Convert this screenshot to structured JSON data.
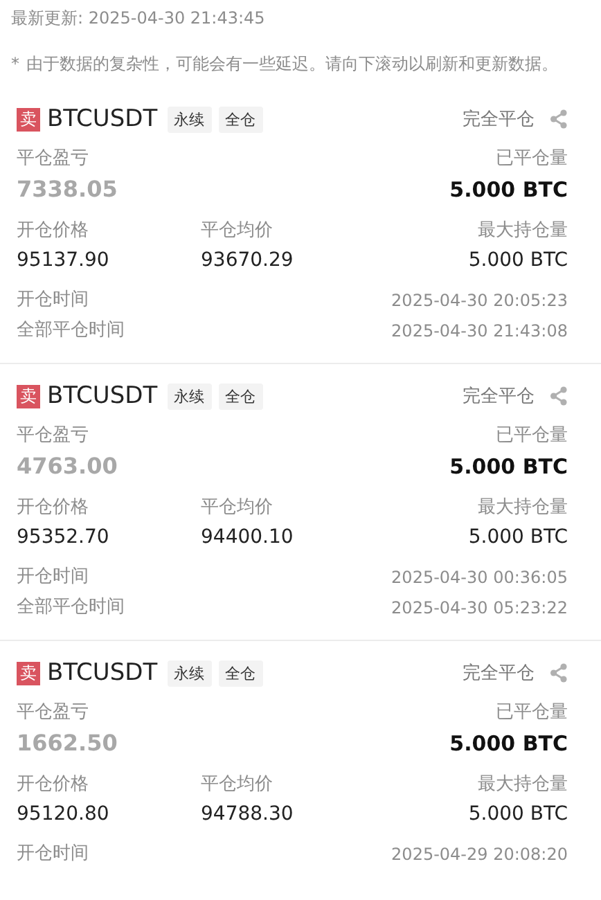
{
  "last_update": "最新更新: 2025-04-30 21:43:45",
  "note_mark": "*",
  "note": "由于数据的复杂性，可能会有一些延迟。请向下滚动以刷新和更新数据。",
  "positions": [
    {
      "side": "卖",
      "symbol": "BTCUSDT",
      "tags": [
        "永续",
        "全仓"
      ],
      "status": "完全平仓",
      "pnl_label": "平仓盈亏",
      "pnl": "7338.05",
      "closed_qty_label": "已平仓量",
      "closed_qty": "5.000 BTC",
      "open_price_label": "开仓价格",
      "open_price": "95137.90",
      "avg_close_label": "平仓均价",
      "avg_close": "93670.29",
      "max_qty_label": "最大持仓量",
      "max_qty": "5.000 BTC",
      "open_time_label": "开仓时间",
      "open_time": "2025-04-30 20:05:23",
      "close_time_label": "全部平仓时间",
      "close_time": "2025-04-30 21:43:08"
    },
    {
      "side": "卖",
      "symbol": "BTCUSDT",
      "tags": [
        "永续",
        "全仓"
      ],
      "status": "完全平仓",
      "pnl_label": "平仓盈亏",
      "pnl": "4763.00",
      "closed_qty_label": "已平仓量",
      "closed_qty": "5.000 BTC",
      "open_price_label": "开仓价格",
      "open_price": "95352.70",
      "avg_close_label": "平仓均价",
      "avg_close": "94400.10",
      "max_qty_label": "最大持仓量",
      "max_qty": "5.000 BTC",
      "open_time_label": "开仓时间",
      "open_time": "2025-04-30 00:36:05",
      "close_time_label": "全部平仓时间",
      "close_time": "2025-04-30 05:23:22"
    },
    {
      "side": "卖",
      "symbol": "BTCUSDT",
      "tags": [
        "永续",
        "全仓"
      ],
      "status": "完全平仓",
      "pnl_label": "平仓盈亏",
      "pnl": "1662.50",
      "closed_qty_label": "已平仓量",
      "closed_qty": "5.000 BTC",
      "open_price_label": "开仓价格",
      "open_price": "95120.80",
      "avg_close_label": "平仓均价",
      "avg_close": "94788.30",
      "max_qty_label": "最大持仓量",
      "max_qty": "5.000 BTC",
      "open_time_label": "开仓时间",
      "open_time": "2025-04-29 20:08:20"
    }
  ]
}
